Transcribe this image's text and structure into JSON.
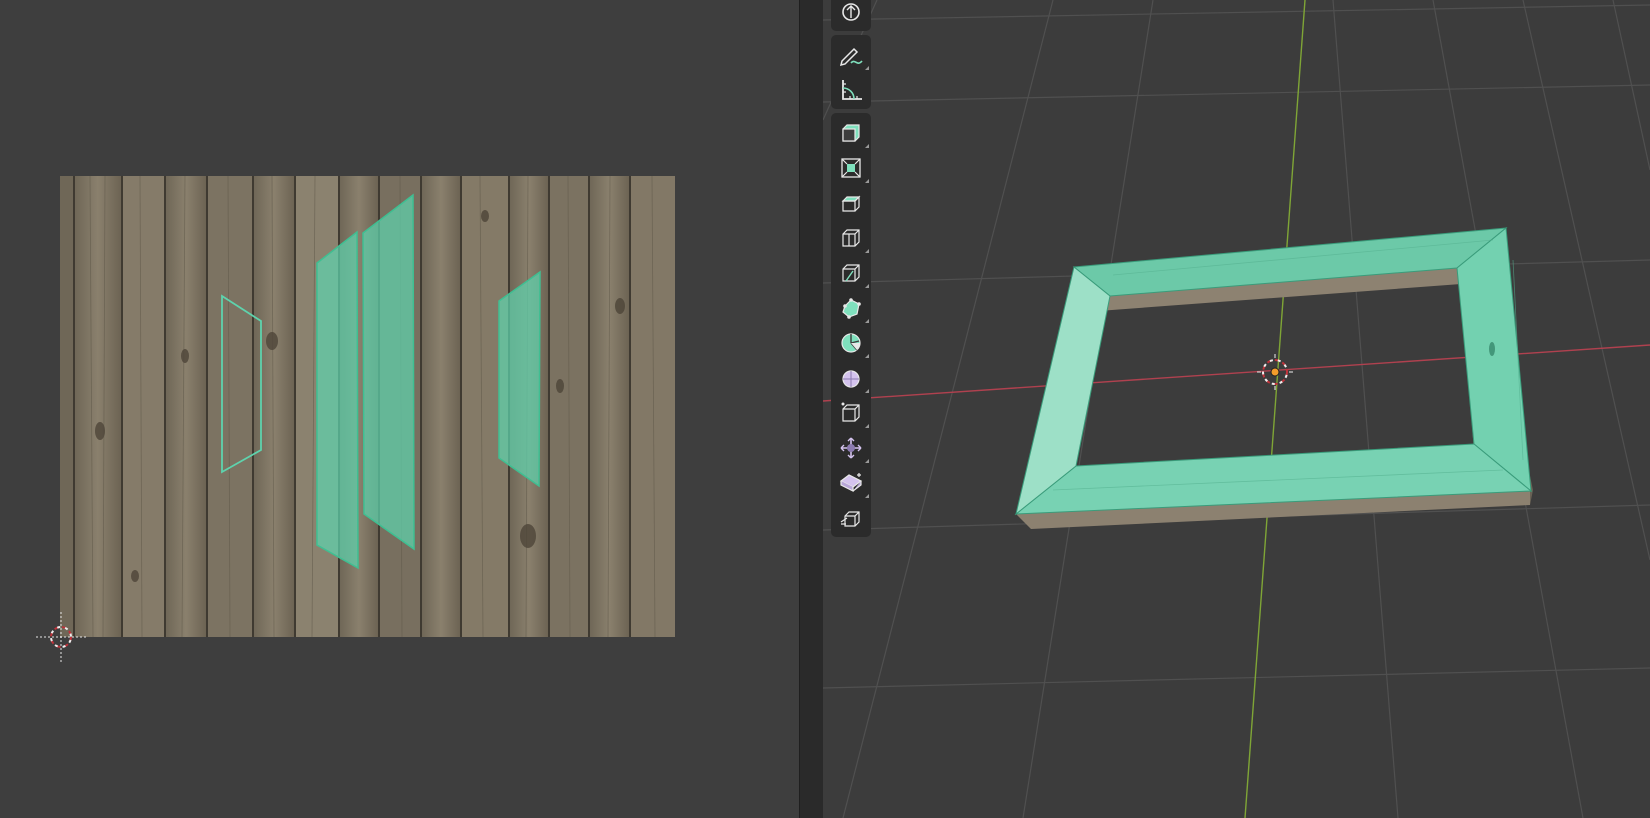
{
  "colors": {
    "editor_bg": "#3e3e3e",
    "viewport_bg": "#3c3c3c",
    "grid": "#4f4f4f",
    "x_axis": "#b0414f",
    "y_axis": "#7fa536",
    "uv_selection": "#5ed3ad",
    "wood_base": "#7d7464",
    "toolbar_bg": "#2b2b2b",
    "tool_accent": "#7fe0bd",
    "tool_accent_alt": "#d4c3ee"
  },
  "toolbar": {
    "groups": [
      [
        "transform-gizmo-icon"
      ],
      [
        "annotate-pencil-icon",
        "measure-ruler-icon"
      ],
      [
        "add-cube-icon",
        "extrude-region-icon",
        "inset-faces-icon",
        "bevel-icon",
        "loop-cut-icon",
        "knife-icon",
        "poly-build-icon",
        "spin-icon",
        "smooth-vertices-icon",
        "edge-slide-icon",
        "shrink-fatten-icon",
        "shear-icon",
        "rip-region-icon"
      ]
    ]
  }
}
